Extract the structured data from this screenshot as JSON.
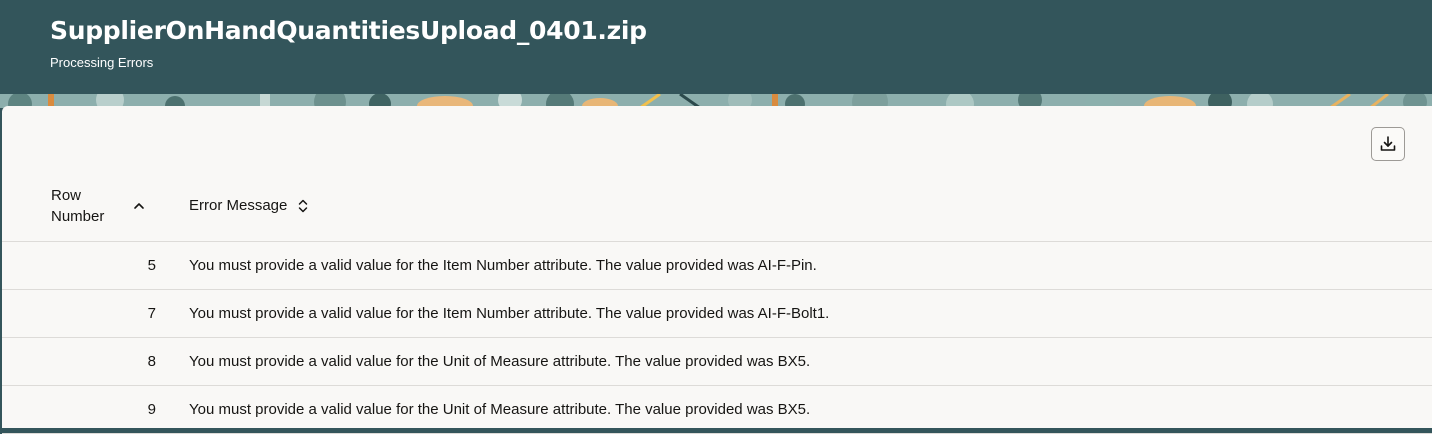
{
  "header": {
    "title": "SupplierOnHandQuantitiesUpload_0401.zip",
    "subtitle": "Processing Errors"
  },
  "toolbar": {
    "export_icon": "download-icon"
  },
  "table": {
    "columns": [
      {
        "label": "Row Number",
        "sort": "ascending",
        "icon": "chevron-up-icon"
      },
      {
        "label": "Error Message",
        "sort": "unsorted",
        "icon": "sort-updown-icon"
      }
    ],
    "rows": [
      {
        "row_number": "5",
        "message": "You must provide a valid value for the Item Number attribute. The value provided was AI-F-Pin."
      },
      {
        "row_number": "7",
        "message": "You must provide a valid value for the Item Number attribute. The value provided was AI-F-Bolt1."
      },
      {
        "row_number": "8",
        "message": "You must provide a valid value for the Unit of Measure attribute. The value provided was BX5."
      },
      {
        "row_number": "9",
        "message": "You must provide a valid value for the Unit of Measure attribute. The value provided was BX5."
      }
    ]
  },
  "colors": {
    "header_bg": "#33555b",
    "panel_bg": "#f9f8f6",
    "text": "#161513",
    "divider": "#dddbd8"
  }
}
